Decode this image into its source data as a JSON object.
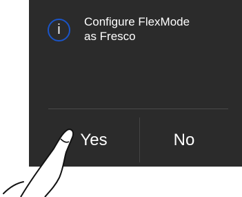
{
  "dialog": {
    "icon": "info-icon",
    "icon_glyph": "i",
    "message_line1": "Configure FlexMode",
    "message_line2": "as Fresco",
    "yes_label": "Yes",
    "no_label": "No"
  },
  "colors": {
    "panel": "#2b2b2b",
    "icon_ring": "#1a55c9",
    "text": "#ffffff"
  }
}
